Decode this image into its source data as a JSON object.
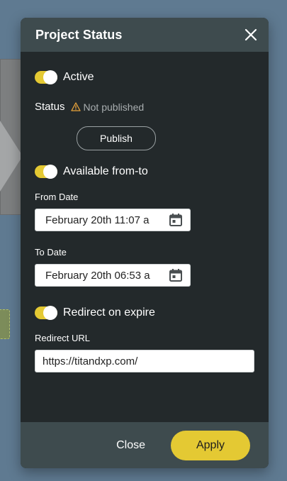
{
  "modal": {
    "title": "Project Status"
  },
  "active": {
    "label": "Active",
    "enabled": true
  },
  "status": {
    "label": "Status",
    "value": "Not published",
    "icon": "warning-icon",
    "icon_color": "#e7a33b"
  },
  "publish": {
    "label": "Publish"
  },
  "availability": {
    "label": "Available from-to",
    "enabled": true,
    "from_label": "From Date",
    "from_value": "February 20th 11:07 a",
    "to_label": "To Date",
    "to_value": "February 20th 06:53 a"
  },
  "redirect": {
    "label": "Redirect on expire",
    "enabled": true,
    "url_label": "Redirect URL",
    "url_value": "https://titandxp.com/"
  },
  "footer": {
    "close_label": "Close",
    "apply_label": "Apply"
  },
  "colors": {
    "accent": "#e4c933",
    "modal_bg": "#23292b",
    "header_bg": "#3e4b4e",
    "page_bg": "#5f7a91"
  }
}
